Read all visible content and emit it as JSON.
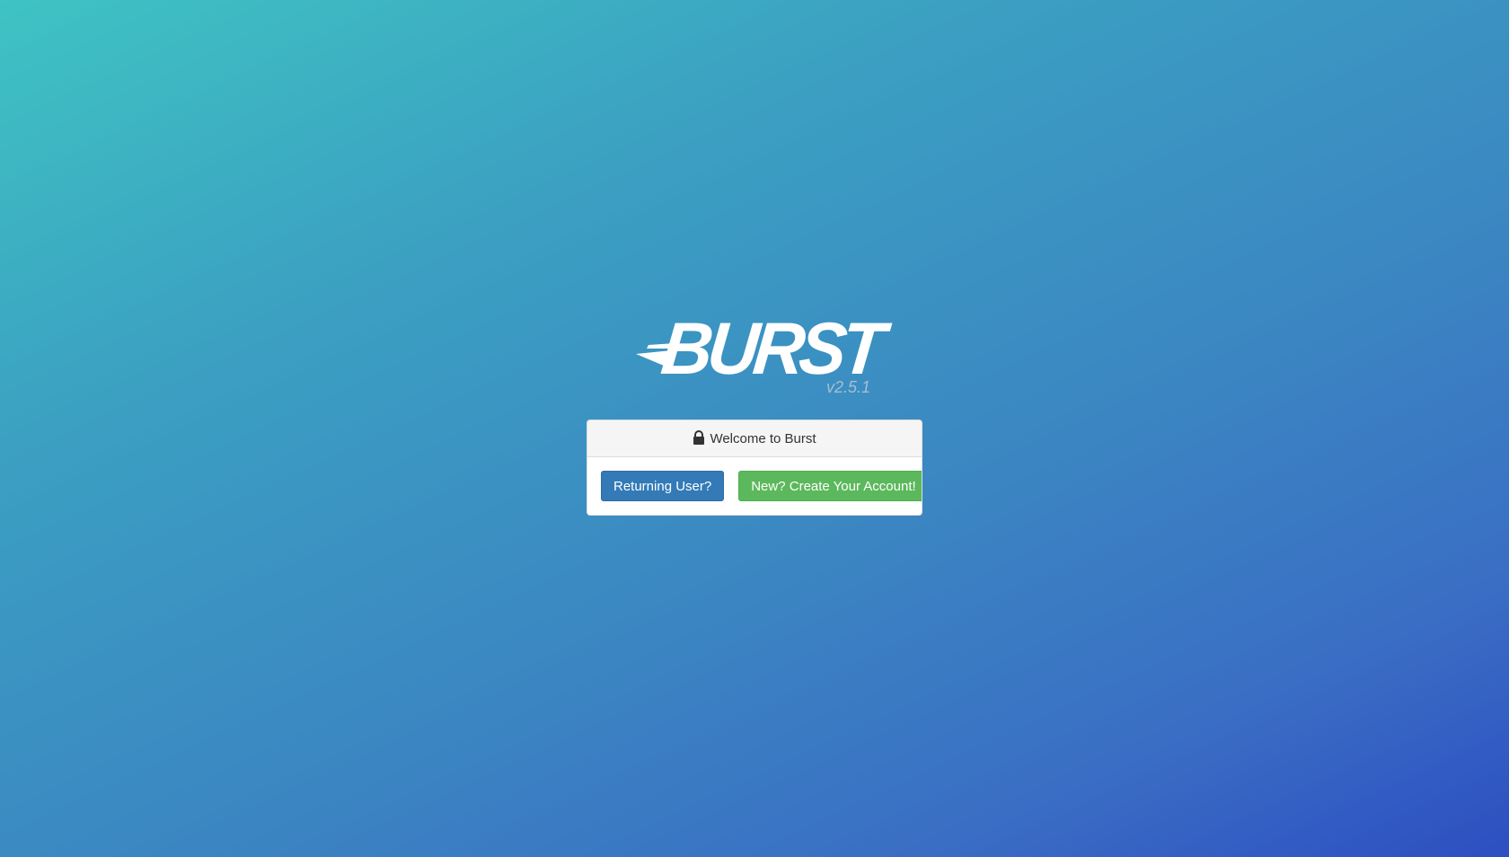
{
  "logo": {
    "text": "BURST",
    "version": "v2.5.1",
    "icon": "burst-logo-streak"
  },
  "panel": {
    "heading_icon": "lock-icon",
    "heading": "Welcome to Burst",
    "buttons": {
      "returning_user": "Returning User?",
      "create_account": "New? Create Your Account!"
    }
  },
  "colors": {
    "background_start": "#3fc3c3",
    "background_end": "#2d4fc2",
    "primary_button": "#337ab7",
    "success_button": "#5cb85c",
    "version_text": "#a9bdd1"
  }
}
